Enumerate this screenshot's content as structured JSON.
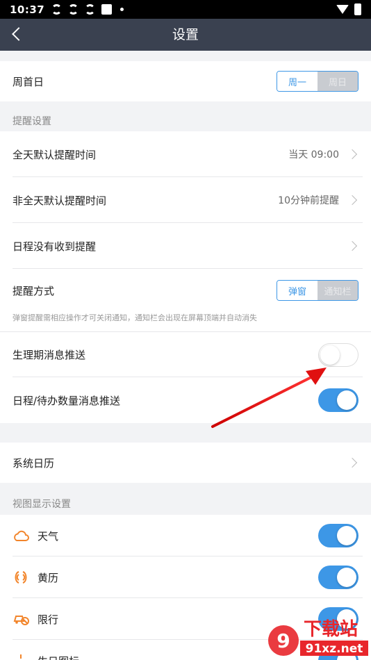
{
  "status": {
    "time": "10:37"
  },
  "topbar": {
    "title": "设置"
  },
  "week_start": {
    "label": "周首日",
    "options": [
      "周一",
      "周日"
    ],
    "selected": "周一"
  },
  "reminder_header": "提醒设置",
  "reminder": {
    "allday_label": "全天默认提醒时间",
    "allday_value": "当天 09:00",
    "nonallday_label": "非全天默认提醒时间",
    "nonallday_value": "10分钟前提醒",
    "not_received_label": "日程没有收到提醒",
    "method_label": "提醒方式",
    "method_options": [
      "弹窗",
      "通知栏"
    ],
    "method_selected": "弹窗",
    "method_hint": "弹窗提醒需相应操作才可关闭通知，通知栏会出现在屏幕顶端并自动消失",
    "period_label": "生理期消息推送",
    "period_on": false,
    "count_label": "日程/待办数量消息推送",
    "count_on": true
  },
  "system_calendar_label": "系统日历",
  "view_header": "视图显示设置",
  "view": [
    {
      "label": "天气",
      "icon": "weather-cloud-icon",
      "on": true
    },
    {
      "label": "黄历",
      "icon": "almanac-icon",
      "on": true
    },
    {
      "label": "限行",
      "icon": "traffic-restriction-icon",
      "on": true
    },
    {
      "label": "生日图标",
      "icon": "birthday-cake-icon",
      "on": true
    }
  ],
  "colors": {
    "accent": "#3d97e6",
    "header": "#3a4150",
    "icon_orange": "#f2852b"
  },
  "watermark": {
    "main": "下载站",
    "sub": "91xz.net"
  }
}
